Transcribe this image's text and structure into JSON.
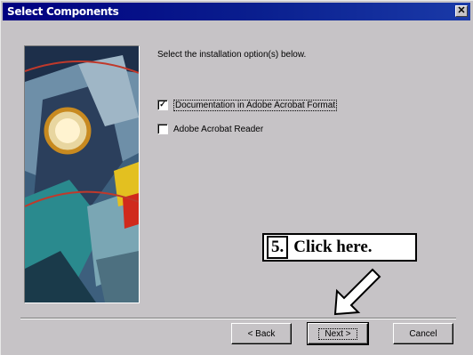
{
  "window": {
    "title": "Select Components",
    "close_symbol": "✕"
  },
  "main": {
    "instruction": "Select the installation option(s) below.",
    "options": [
      {
        "label": "Documentation in Adobe Acrobat Format",
        "checked": true,
        "check_symbol": "✓"
      },
      {
        "label": "Adobe Acrobat Reader",
        "checked": false,
        "check_symbol": ""
      }
    ]
  },
  "buttons": {
    "back": "< Back",
    "next": "Next >",
    "cancel": "Cancel"
  },
  "annotation": {
    "step": "5.",
    "text": "Click here."
  },
  "colors": {
    "titlebar": "#000080",
    "face": "#c6c3c6"
  }
}
